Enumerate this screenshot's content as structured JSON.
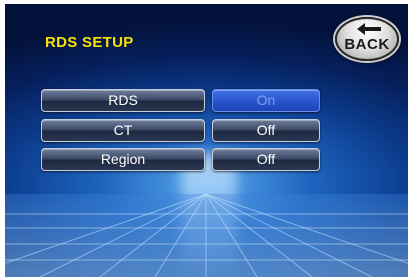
{
  "screen": {
    "title": "RDS SETUP"
  },
  "back_button": {
    "label": "BACK"
  },
  "settings": [
    {
      "label": "RDS",
      "value": "On",
      "active": true
    },
    {
      "label": "CT",
      "value": "Off",
      "active": false
    },
    {
      "label": "Region",
      "value": "Off",
      "active": false
    }
  ]
}
